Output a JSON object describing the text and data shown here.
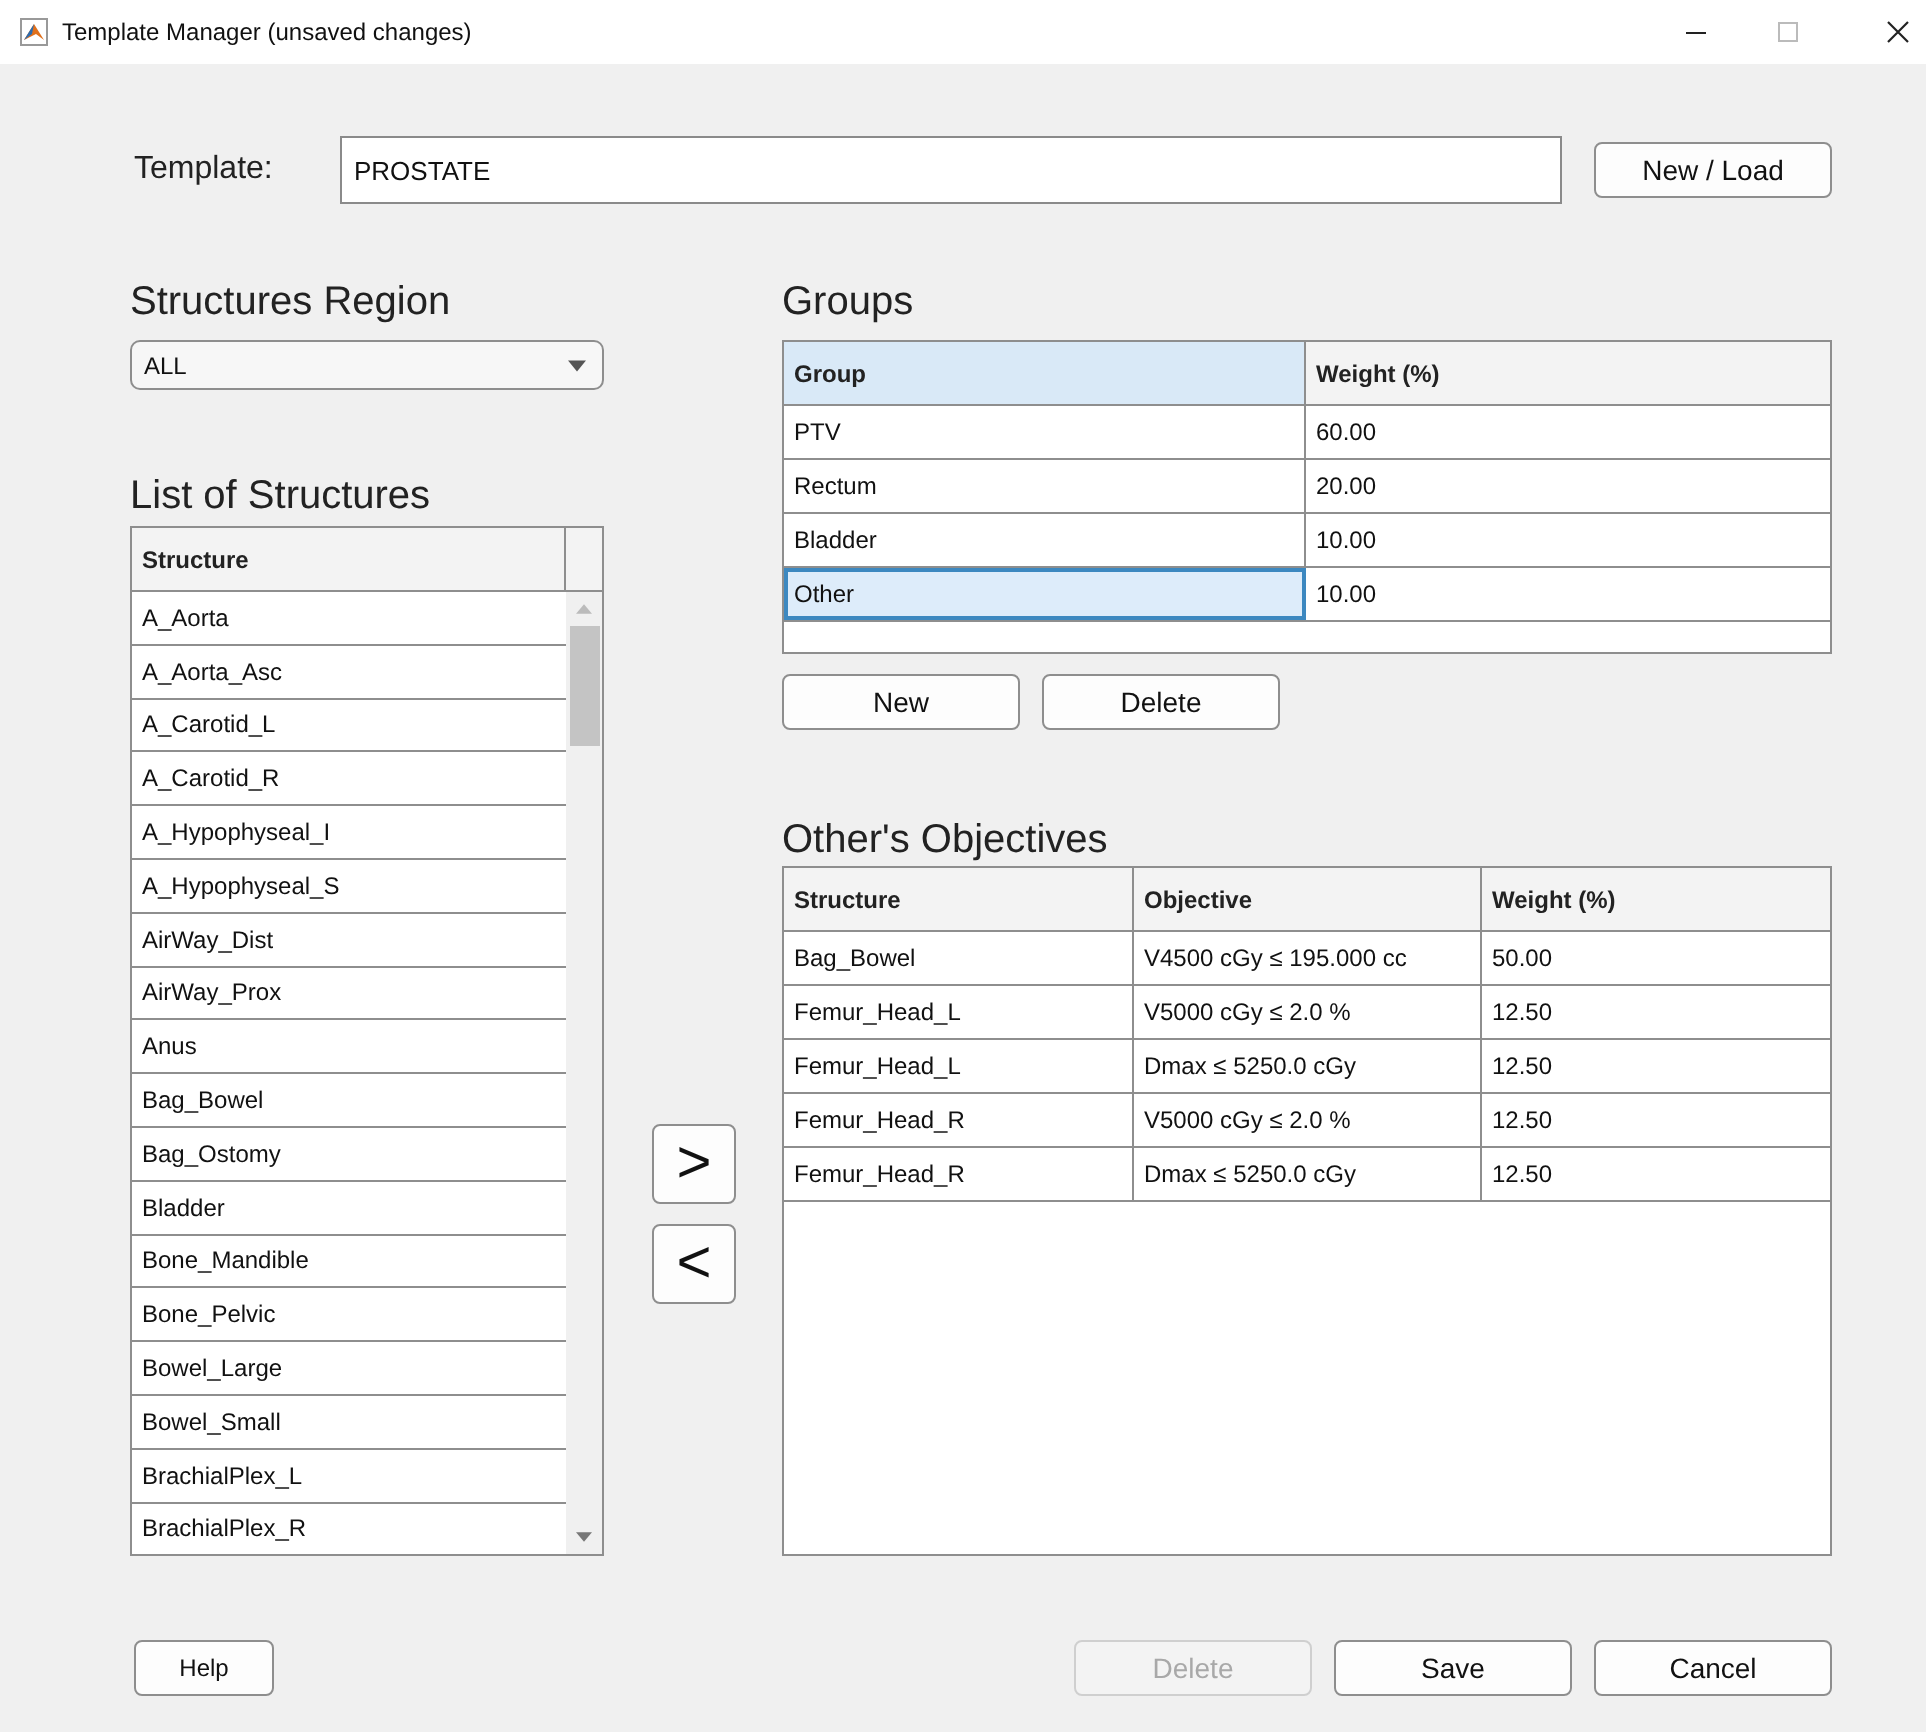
{
  "window": {
    "title": "Template Manager (unsaved changes)"
  },
  "template": {
    "label": "Template:",
    "value": "PROSTATE",
    "button": "New / Load"
  },
  "structures_region": {
    "heading": "Structures Region",
    "value": "ALL"
  },
  "structure_list": {
    "heading": "List of Structures",
    "column": "Structure",
    "items": [
      "A_Aorta",
      "A_Aorta_Asc",
      "A_Carotid_L",
      "A_Carotid_R",
      "A_Hypophyseal_I",
      "A_Hypophyseal_S",
      "AirWay_Dist",
      "AirWay_Prox",
      "Anus",
      "Bag_Bowel",
      "Bag_Ostomy",
      "Bladder",
      "Bone_Mandible",
      "Bone_Pelvic",
      "Bowel_Large",
      "Bowel_Small",
      "BrachialPlex_L",
      "BrachialPlex_R"
    ]
  },
  "move_buttons": [
    ">",
    "<"
  ],
  "groups": {
    "heading": "Groups",
    "columns": [
      {
        "label": "Group",
        "selected": true
      },
      {
        "label": "Weight (%)",
        "selected": false
      }
    ],
    "rows": [
      {
        "group": "PTV",
        "weight": "60.00",
        "selected": false
      },
      {
        "group": "Rectum",
        "weight": "20.00",
        "selected": false
      },
      {
        "group": "Bladder",
        "weight": "10.00",
        "selected": false
      },
      {
        "group": "Other",
        "weight": "10.00",
        "selected": true
      }
    ],
    "buttons": [
      "New",
      "Delete"
    ]
  },
  "objectives": {
    "heading": "Other's Objectives",
    "columns": [
      "Structure",
      "Objective",
      "Weight (%)"
    ],
    "rows": [
      [
        "Bag_Bowel",
        "V4500 cGy ≤ 195.000 cc",
        "50.00"
      ],
      [
        "Femur_Head_L",
        "V5000 cGy ≤ 2.0 %",
        "12.50"
      ],
      [
        "Femur_Head_L",
        "Dmax ≤ 5250.0 cGy",
        "12.50"
      ],
      [
        "Femur_Head_R",
        "V5000 cGy ≤ 2.0 %",
        "12.50"
      ],
      [
        "Femur_Head_R",
        "Dmax ≤ 5250.0 cGy",
        "12.50"
      ]
    ]
  },
  "footer": {
    "help": "Help",
    "buttons": [
      {
        "label": "Delete",
        "disabled": true
      },
      {
        "label": "Save",
        "disabled": false
      },
      {
        "label": "Cancel",
        "disabled": false
      }
    ]
  }
}
